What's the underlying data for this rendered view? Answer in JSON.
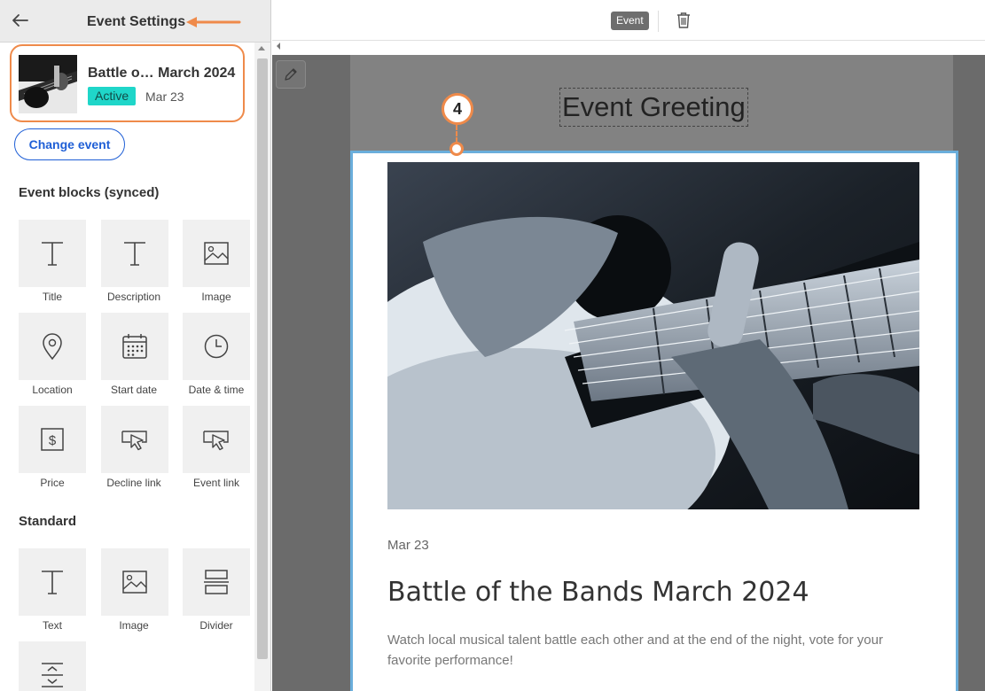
{
  "sidebar": {
    "title": "Event Settings",
    "event": {
      "name": "Battle o… March 2024",
      "status": "Active",
      "date": "Mar 23"
    },
    "change_event_label": "Change event",
    "event_blocks_heading": "Event blocks (synced)",
    "event_blocks": [
      {
        "label": "Title",
        "icon": "text-T-icon"
      },
      {
        "label": "Description",
        "icon": "text-T-icon"
      },
      {
        "label": "Image",
        "icon": "image-icon"
      },
      {
        "label": "Location",
        "icon": "location-pin-icon"
      },
      {
        "label": "Start date",
        "icon": "calendar-icon"
      },
      {
        "label": "Date & time",
        "icon": "clock-icon"
      },
      {
        "label": "Price",
        "icon": "dollar-icon"
      },
      {
        "label": "Decline link",
        "icon": "cursor-link-icon"
      },
      {
        "label": "Event link",
        "icon": "cursor-link-icon"
      }
    ],
    "standard_heading": "Standard",
    "standard_blocks": [
      {
        "label": "Text",
        "icon": "text-T-icon"
      },
      {
        "label": "Image",
        "icon": "image-icon"
      },
      {
        "label": "Divider",
        "icon": "divider-icon"
      },
      {
        "label": "",
        "icon": "spacer-icon"
      }
    ]
  },
  "toolbar": {
    "event_tag": "Event"
  },
  "editor": {
    "greeting": "Event Greeting",
    "date": "Mar 23",
    "title": "Battle of the Bands March 2024",
    "description": "Watch local musical talent battle each other and at the end of the night, vote for your favorite performance!"
  },
  "annotation": {
    "step": "4"
  },
  "colors": {
    "accent_orange": "#ef8a4a",
    "active_badge": "#1fd6c9",
    "link_blue": "#1f5fd6",
    "selection_blue": "#6aaedb"
  }
}
